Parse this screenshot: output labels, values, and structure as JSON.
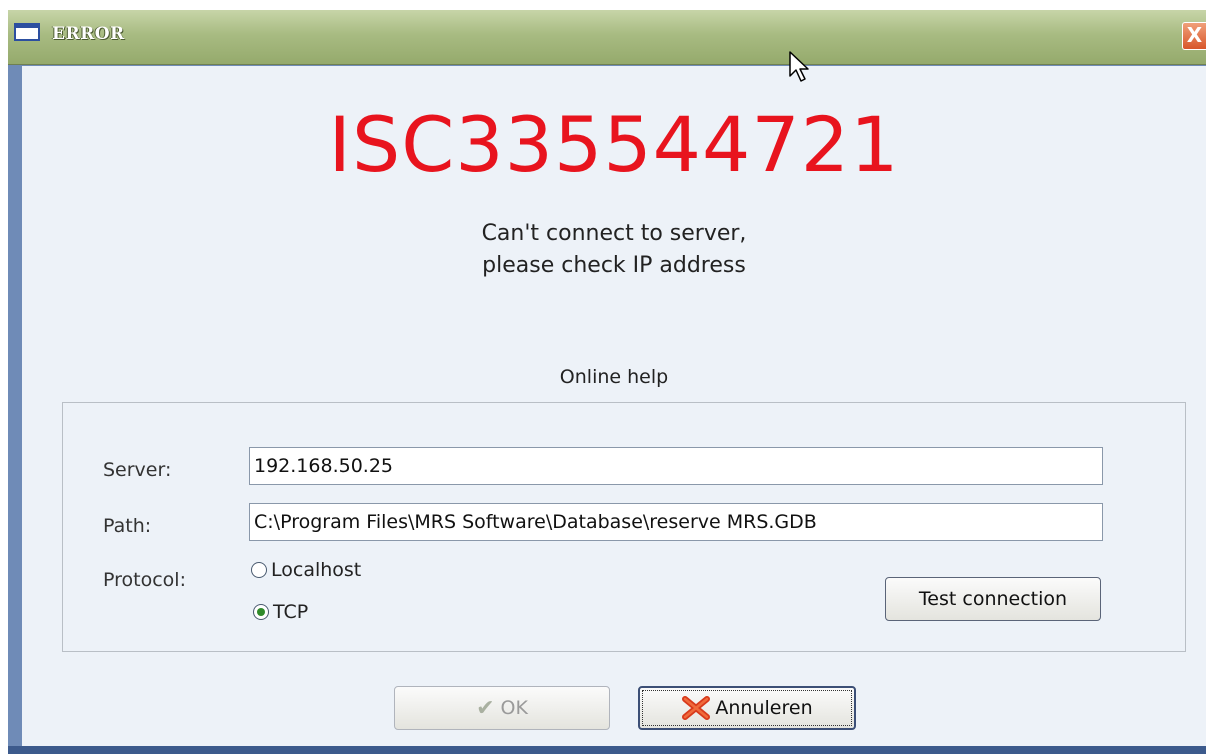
{
  "window": {
    "title": "ERROR",
    "close_symbol": "X"
  },
  "error": {
    "code": "ISC335544721",
    "message_line1": "Can't connect to server,",
    "message_line2": "please check IP address"
  },
  "online_help": "Online help",
  "connection": {
    "server_label": "Server:",
    "server_value": "192.168.50.25",
    "path_label": "Path:",
    "path_value": "C:\\Program Files\\MRS Software\\Database\\reserve MRS.GDB",
    "protocol_label": "Protocol:",
    "protocol_options": [
      {
        "label": "Localhost",
        "selected": false
      },
      {
        "label": "TCP",
        "selected": true
      }
    ],
    "test_button": "Test connection"
  },
  "buttons": {
    "ok": "OK",
    "cancel": "Annuleren"
  },
  "colors": {
    "error_code": "#e8141e",
    "titlebar": "#a8bb82"
  }
}
